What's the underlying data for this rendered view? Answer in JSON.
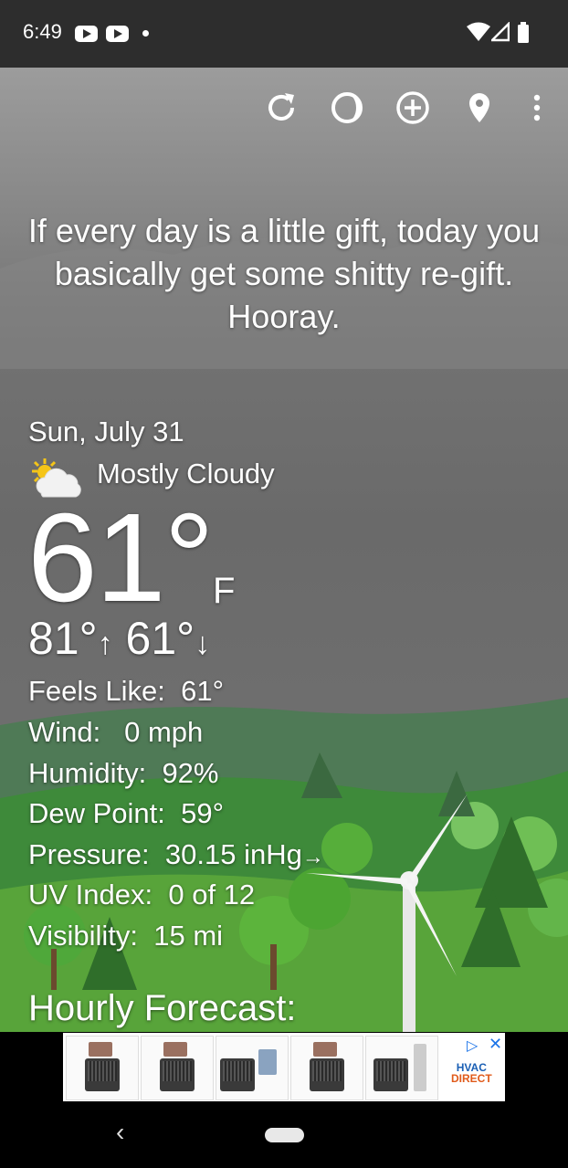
{
  "status_bar": {
    "time": "6:49",
    "notification_icons": [
      "youtube-icon",
      "youtube-icon",
      "dot-icon"
    ],
    "system_icons": [
      "wifi-icon",
      "signal-icon",
      "battery-icon"
    ]
  },
  "toolbar": {
    "icons": [
      "refresh-icon",
      "theme-icon",
      "add-location-icon",
      "location-pin-icon",
      "overflow-menu-icon"
    ]
  },
  "quote": "If every day is a little gift, today you basically get some shitty re-gift. Hooray.",
  "weather": {
    "date": "Sun, July 31",
    "condition": "Mostly Cloudy",
    "condition_icon": "partly-cloudy-icon",
    "temperature": "61°",
    "unit": "F",
    "high": "81°",
    "low": "61°",
    "high_arrow": "↑",
    "low_arrow": "↓"
  },
  "details": [
    {
      "label": "Feels Like:",
      "value": "61°"
    },
    {
      "label": "Wind:",
      "value": "0 mph"
    },
    {
      "label": "Humidity:",
      "value": "92%"
    },
    {
      "label": "Dew Point:",
      "value": "59°"
    },
    {
      "label": "Pressure:",
      "value": "30.15 inHg",
      "trend": "→"
    },
    {
      "label": "UV Index:",
      "value": "0 of 12"
    },
    {
      "label": "Visibility:",
      "value": "15 mi"
    }
  ],
  "hourly_heading": "Hourly Forecast:",
  "ad": {
    "brand_line1": "HVAC",
    "brand_line2": "DIRECT",
    "close_glyph": "✕",
    "adchoices_glyph": "▷"
  },
  "navbar": {
    "back_glyph": "‹"
  }
}
